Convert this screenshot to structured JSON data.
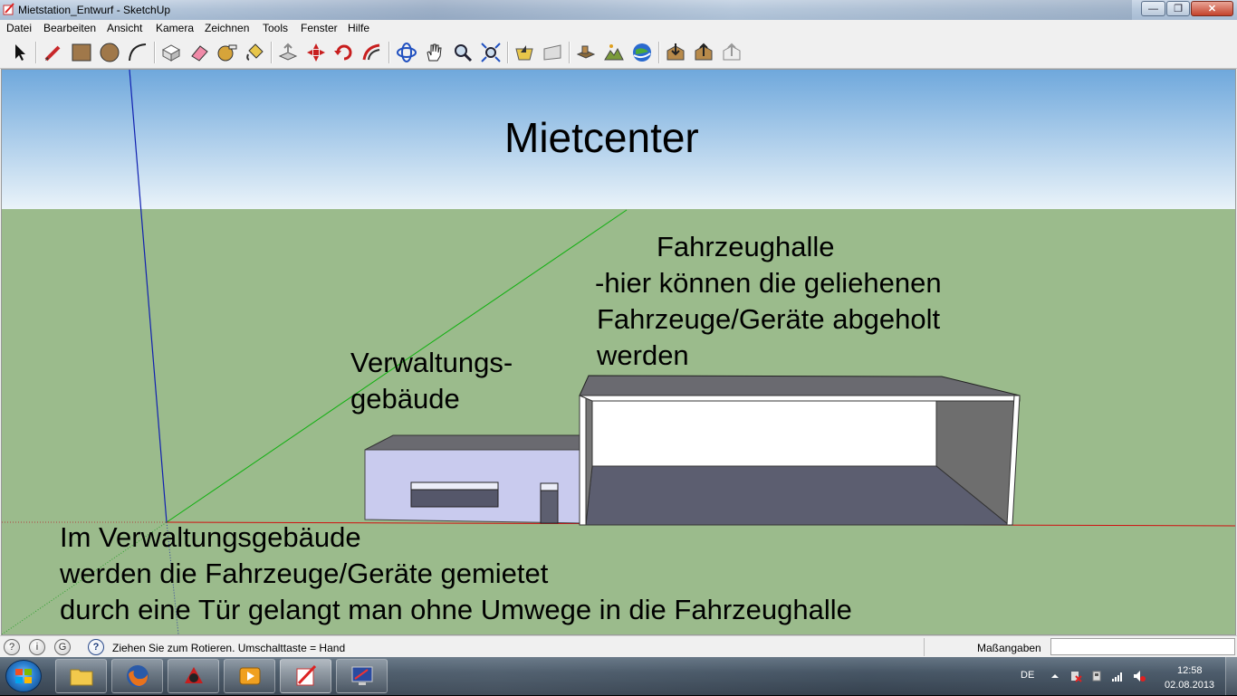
{
  "window": {
    "title": "Mietstation_Entwurf - SketchUp"
  },
  "menu": [
    "Datei",
    "Bearbeiten",
    "Ansicht",
    "Kamera",
    "Zeichnen",
    "Tools",
    "Fenster",
    "Hilfe"
  ],
  "toolbar": {
    "tools": [
      {
        "name": "select-tool-button",
        "icon": "arrow-cursor"
      },
      {
        "name": "pencil-line-tool-button",
        "icon": "pencil"
      },
      {
        "name": "rectangle-tool-button",
        "icon": "rectangle"
      },
      {
        "name": "circle-tool-button",
        "icon": "circle"
      },
      {
        "name": "arc-tool-button",
        "icon": "arc"
      },
      {
        "name": "make-component-button",
        "icon": "component"
      },
      {
        "name": "eraser-tool-button",
        "icon": "eraser"
      },
      {
        "name": "tape-measure-tool-button",
        "icon": "tape-measure"
      },
      {
        "name": "paint-bucket-tool-button",
        "icon": "paint-bucket"
      },
      {
        "name": "push-pull-tool-button",
        "icon": "push-pull"
      },
      {
        "name": "move-tool-button",
        "icon": "move"
      },
      {
        "name": "rotate-tool-button",
        "icon": "rotate"
      },
      {
        "name": "offset-tool-button",
        "icon": "offset"
      },
      {
        "name": "orbit-tool-button",
        "icon": "orbit"
      },
      {
        "name": "pan-tool-button",
        "icon": "hand"
      },
      {
        "name": "zoom-tool-button",
        "icon": "magnifier"
      },
      {
        "name": "zoom-extents-button",
        "icon": "zoom-extents"
      },
      {
        "name": "previous-view-button",
        "icon": "previous-view"
      },
      {
        "name": "next-view-button",
        "icon": "next-view"
      },
      {
        "name": "add-location-button",
        "icon": "add-location"
      },
      {
        "name": "toggle-terrain-button",
        "icon": "terrain"
      },
      {
        "name": "preview-google-earth-button",
        "icon": "google-earth"
      },
      {
        "name": "get-models-button",
        "icon": "get-models"
      },
      {
        "name": "share-model-button",
        "icon": "share-model"
      },
      {
        "name": "share-component-button",
        "icon": "share-component"
      }
    ]
  },
  "scene": {
    "title": "Mietcenter",
    "label_hall": [
      "Fahrzeughalle",
      "-hier können die geliehenen",
      " Fahrzeuge/Geräte abgeholt",
      " werden"
    ],
    "label_admin": [
      "Verwaltungs-",
      "gebäude"
    ],
    "label_desc": [
      "Im Verwaltungsgebäude",
      "werden die Fahrzeuge/Geräte gemietet",
      "durch eine Tür gelangt man ohne Umwege in die Fahrzeughalle"
    ],
    "colors": {
      "sky_top": "#6fa8dc",
      "sky_bottom": "#e8f2f8",
      "ground": "#9bbb8c",
      "admin_front": "#c9cbee",
      "roof": "#6a6a70",
      "hall_floor": "#5c5e70",
      "hall_wall": "#6a6a6a",
      "axis_red": "#d01010",
      "axis_green": "#10b010",
      "axis_blue": "#1020b0"
    }
  },
  "status": {
    "text": "Ziehen Sie zum Rotieren.  Umschalttaste = Hand",
    "measure_label": "Maßangaben",
    "measure_value": ""
  },
  "taskbar": {
    "apps": [
      "file-explorer",
      "firefox",
      "unknown-red-app",
      "media-player",
      "sketchup",
      "screen-tool"
    ],
    "lang": "DE",
    "time": "12:58",
    "date": "02.08.2013"
  }
}
